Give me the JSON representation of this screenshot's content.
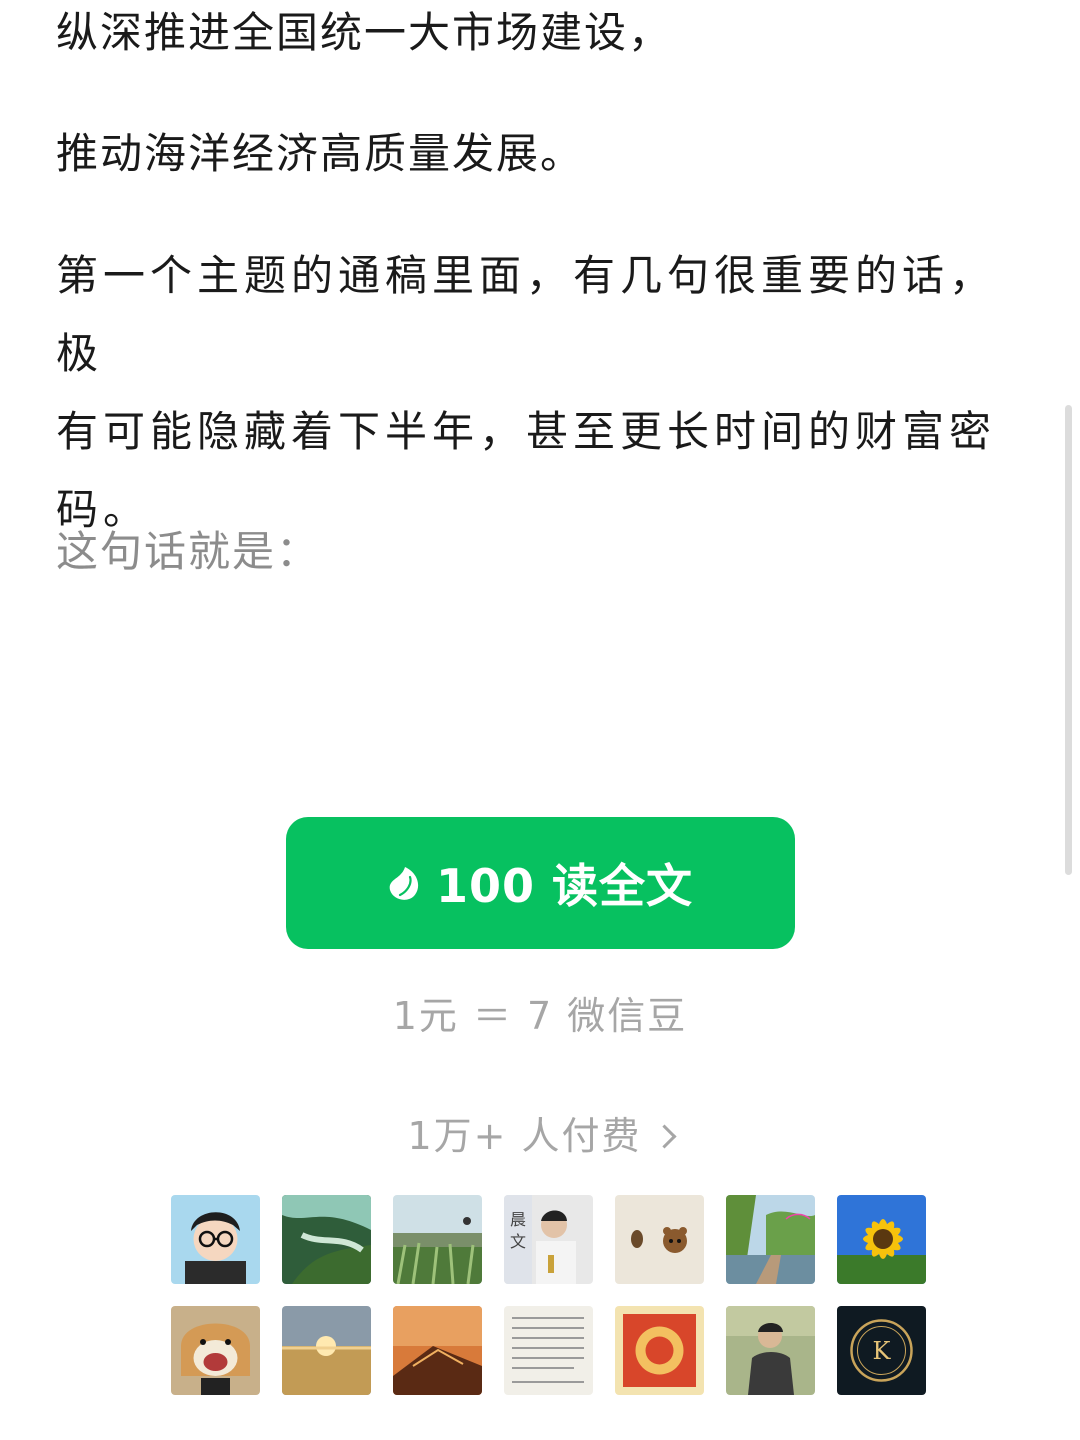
{
  "article": {
    "p1": "纵深推进全国统一大市场建设，",
    "p2": "推动海洋经济高质量发展。",
    "p3": "第一个主题的通稿里面，有几句很重要的话，极\n有可能隐藏着下半年，甚至更长时间的财富密\n码。",
    "p4": "这句话就是："
  },
  "paywall": {
    "button_label": "100 读全文",
    "icon": "wechat-bean-icon",
    "rate_text": "1元 ＝ 7 微信豆",
    "payers_text": "1万+ 人付费"
  },
  "colors": {
    "accent": "#07c160",
    "muted_text": "#a6a6a6"
  }
}
